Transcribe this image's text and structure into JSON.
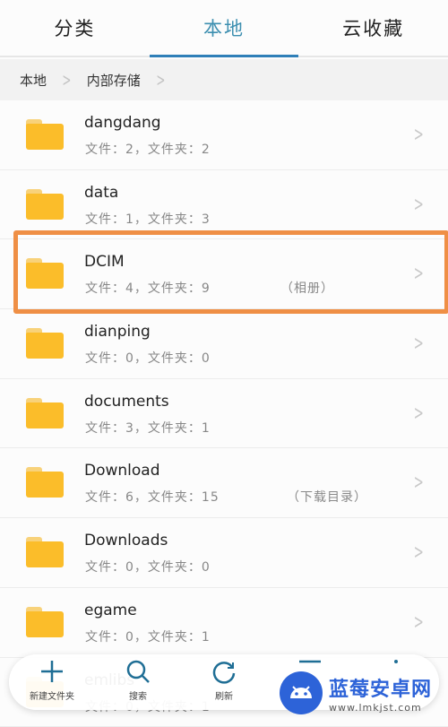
{
  "tabs": [
    {
      "label": "分类"
    },
    {
      "label": "本地",
      "active": true
    },
    {
      "label": "云收藏"
    }
  ],
  "breadcrumb": [
    "本地",
    "内部存储"
  ],
  "folders": [
    {
      "name": "dangdang",
      "meta": "文件：2，文件夹：2",
      "note": ""
    },
    {
      "name": "data",
      "meta": "文件：1，文件夹：3",
      "note": ""
    },
    {
      "name": "DCIM",
      "meta": "文件：4，文件夹：9",
      "note": "（相册）"
    },
    {
      "name": "dianping",
      "meta": "文件：0，文件夹：0",
      "note": ""
    },
    {
      "name": "documents",
      "meta": "文件：3，文件夹：1",
      "note": ""
    },
    {
      "name": "Download",
      "meta": "文件：6，文件夹：15",
      "note": "（下载目录）"
    },
    {
      "name": "Downloads",
      "meta": "文件：0，文件夹：0",
      "note": ""
    },
    {
      "name": "egame",
      "meta": "文件：0，文件夹：1",
      "note": ""
    },
    {
      "name": "emlibs",
      "meta": "文件：0，文件夹：1",
      "note": ""
    }
  ],
  "toolbar": {
    "new_folder": "新建文件夹",
    "search": "搜索",
    "refresh": "刷新"
  },
  "watermark": {
    "title": "蓝莓安卓网",
    "url": "www.lmkjst.com"
  },
  "colors": {
    "accent": "#2f7fb8",
    "folder": "#fbbd2a",
    "highlight": "#ef8f45"
  }
}
